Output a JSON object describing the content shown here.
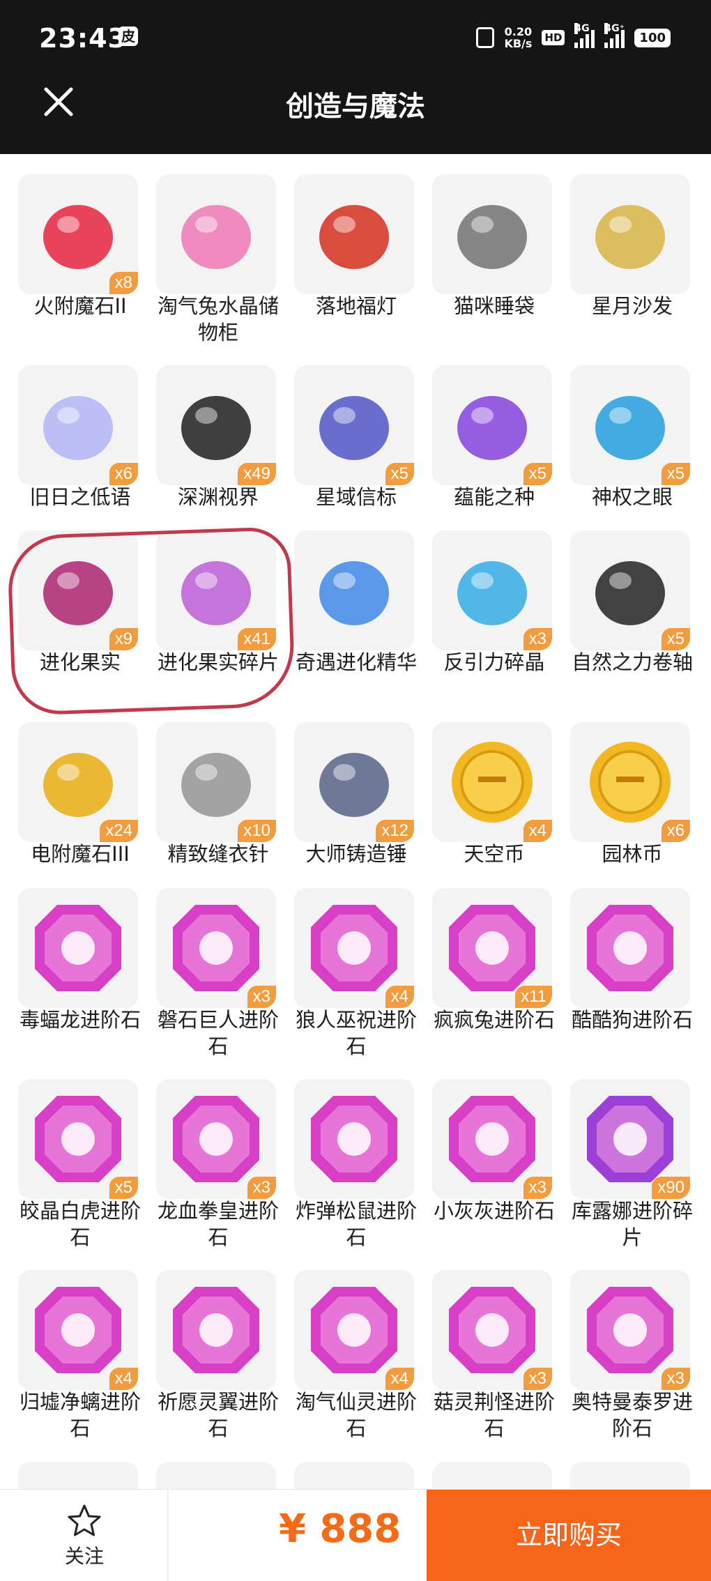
{
  "status_bar": {
    "time": "23:43",
    "badge": "皮",
    "net_speed_value": "0.20",
    "net_speed_unit": "KB/s",
    "hd": "HD",
    "sim1": "4G",
    "sim2": "4G⁺",
    "battery": "100"
  },
  "header": {
    "title": "创造与魔法"
  },
  "items": [
    {
      "name": "火附魔石II",
      "qty": "x8",
      "icon": "red-crystal-icon",
      "color": "#e8304a"
    },
    {
      "name": "淘气兔水晶储物柜",
      "qty": "",
      "icon": "pink-cabinet-icon",
      "color": "#ee7fb8"
    },
    {
      "name": "落地福灯",
      "qty": "",
      "icon": "lantern-icon",
      "color": "#d63a2a"
    },
    {
      "name": "猫咪睡袋",
      "qty": "",
      "icon": "cat-sleeping-bag-icon",
      "color": "#7a7a7a"
    },
    {
      "name": "星月沙发",
      "qty": "",
      "icon": "sofa-icon",
      "color": "#d9b84e"
    },
    {
      "name": "旧日之低语",
      "qty": "x6",
      "icon": "orb-icon",
      "color": "#b6b9f5"
    },
    {
      "name": "深渊视界",
      "qty": "x49",
      "icon": "abyss-sun-icon",
      "color": "#2b2b2b"
    },
    {
      "name": "星域信标",
      "qty": "x5",
      "icon": "beacon-icon",
      "color": "#5a5ec9"
    },
    {
      "name": "蕴能之种",
      "qty": "x5",
      "icon": "purple-crystal-icon",
      "color": "#8b4ee0"
    },
    {
      "name": "神权之眼",
      "qty": "x5",
      "icon": "divine-eye-icon",
      "color": "#2fa3e0"
    },
    {
      "name": "进化果实",
      "qty": "x9",
      "icon": "evolution-fruit-icon",
      "color": "#b0307a"
    },
    {
      "name": "进化果实碎片",
      "qty": "x41",
      "icon": "fruit-fragment-icon",
      "color": "#c066d8"
    },
    {
      "name": "奇遇进化精华",
      "qty": "",
      "icon": "blue-fruit-icon",
      "color": "#4a8ee8"
    },
    {
      "name": "反引力碎晶",
      "qty": "x3",
      "icon": "antigravity-crystal-icon",
      "color": "#3fb0e8"
    },
    {
      "name": "自然之力卷轴",
      "qty": "x5",
      "icon": "scroll-icon",
      "color": "#2f2f2f"
    },
    {
      "name": "电附魔石III",
      "qty": "x24",
      "icon": "gold-crystal-icon",
      "color": "#e9b11e"
    },
    {
      "name": "精致缝衣针",
      "qty": "x10",
      "icon": "needle-icon",
      "color": "#9a9a9a"
    },
    {
      "name": "大师铸造锤",
      "qty": "x12",
      "icon": "hammer-icon",
      "color": "#5e6b8c"
    },
    {
      "name": "天空币",
      "qty": "x4",
      "icon": "sky-coin-icon",
      "color": "#f2b822"
    },
    {
      "name": "园林币",
      "qty": "x6",
      "icon": "garden-coin-icon",
      "color": "#f2b822"
    },
    {
      "name": "毒蝠龙进阶石",
      "qty": "",
      "icon": "bat-dragon-gem-icon",
      "color": "#d63fc6"
    },
    {
      "name": "磐石巨人进阶石",
      "qty": "x3",
      "icon": "rock-giant-gem-icon",
      "color": "#d63fc6"
    },
    {
      "name": "狼人巫祝进阶石",
      "qty": "x4",
      "icon": "werewolf-gem-icon",
      "color": "#d63fc6"
    },
    {
      "name": "疯疯兔进阶石",
      "qty": "x11",
      "icon": "crazy-rabbit-gem-icon",
      "color": "#d63fc6"
    },
    {
      "name": "酷酷狗进阶石",
      "qty": "",
      "icon": "cool-dog-gem-icon",
      "color": "#d63fc6"
    },
    {
      "name": "皎晶白虎进阶石",
      "qty": "x5",
      "icon": "white-tiger-gem-icon",
      "color": "#d63fc6"
    },
    {
      "name": "龙血拳皇进阶石",
      "qty": "x3",
      "icon": "dragon-fist-gem-icon",
      "color": "#d63fc6"
    },
    {
      "name": "炸弹松鼠进阶石",
      "qty": "",
      "icon": "bomb-squirrel-gem-icon",
      "color": "#d63fc6"
    },
    {
      "name": "小灰灰进阶石",
      "qty": "x3",
      "icon": "little-grey-gem-icon",
      "color": "#d63fc6"
    },
    {
      "name": "库露娜进阶碎片",
      "qty": "x90",
      "icon": "kuluna-gem-icon",
      "color": "#9b3fd6"
    },
    {
      "name": "归墟净螭进阶石",
      "qty": "x4",
      "icon": "guixu-gem-icon",
      "color": "#d63fc6"
    },
    {
      "name": "祈愿灵翼进阶石",
      "qty": "",
      "icon": "wish-wing-gem-icon",
      "color": "#d63fc6"
    },
    {
      "name": "淘气仙灵进阶石",
      "qty": "x4",
      "icon": "naughty-fairy-gem-icon",
      "color": "#d63fc6"
    },
    {
      "name": "菇灵荆怪进阶石",
      "qty": "x3",
      "icon": "mushroom-gem-icon",
      "color": "#d63fc6"
    },
    {
      "name": "奥特曼泰罗进阶石",
      "qty": "x3",
      "icon": "taro-gem-icon",
      "color": "#d63fc6"
    }
  ],
  "bottom": {
    "follow_label": "关注",
    "price": "¥ 888",
    "buy_label": "立即购买"
  }
}
